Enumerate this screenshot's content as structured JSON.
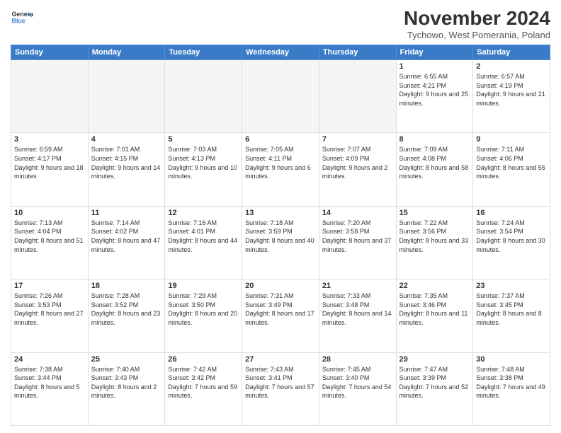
{
  "header": {
    "logo_line1": "General",
    "logo_line2": "Blue",
    "month": "November 2024",
    "location": "Tychowo, West Pomerania, Poland"
  },
  "columns": [
    "Sunday",
    "Monday",
    "Tuesday",
    "Wednesday",
    "Thursday",
    "Friday",
    "Saturday"
  ],
  "weeks": [
    [
      {
        "day": "",
        "info": ""
      },
      {
        "day": "",
        "info": ""
      },
      {
        "day": "",
        "info": ""
      },
      {
        "day": "",
        "info": ""
      },
      {
        "day": "",
        "info": ""
      },
      {
        "day": "1",
        "info": "Sunrise: 6:55 AM\nSunset: 4:21 PM\nDaylight: 9 hours\nand 25 minutes."
      },
      {
        "day": "2",
        "info": "Sunrise: 6:57 AM\nSunset: 4:19 PM\nDaylight: 9 hours\nand 21 minutes."
      }
    ],
    [
      {
        "day": "3",
        "info": "Sunrise: 6:59 AM\nSunset: 4:17 PM\nDaylight: 9 hours\nand 18 minutes."
      },
      {
        "day": "4",
        "info": "Sunrise: 7:01 AM\nSunset: 4:15 PM\nDaylight: 9 hours\nand 14 minutes."
      },
      {
        "day": "5",
        "info": "Sunrise: 7:03 AM\nSunset: 4:13 PM\nDaylight: 9 hours\nand 10 minutes."
      },
      {
        "day": "6",
        "info": "Sunrise: 7:05 AM\nSunset: 4:11 PM\nDaylight: 9 hours\nand 6 minutes."
      },
      {
        "day": "7",
        "info": "Sunrise: 7:07 AM\nSunset: 4:09 PM\nDaylight: 9 hours\nand 2 minutes."
      },
      {
        "day": "8",
        "info": "Sunrise: 7:09 AM\nSunset: 4:08 PM\nDaylight: 8 hours\nand 58 minutes."
      },
      {
        "day": "9",
        "info": "Sunrise: 7:11 AM\nSunset: 4:06 PM\nDaylight: 8 hours\nand 55 minutes."
      }
    ],
    [
      {
        "day": "10",
        "info": "Sunrise: 7:13 AM\nSunset: 4:04 PM\nDaylight: 8 hours\nand 51 minutes."
      },
      {
        "day": "11",
        "info": "Sunrise: 7:14 AM\nSunset: 4:02 PM\nDaylight: 8 hours\nand 47 minutes."
      },
      {
        "day": "12",
        "info": "Sunrise: 7:16 AM\nSunset: 4:01 PM\nDaylight: 8 hours\nand 44 minutes."
      },
      {
        "day": "13",
        "info": "Sunrise: 7:18 AM\nSunset: 3:59 PM\nDaylight: 8 hours\nand 40 minutes."
      },
      {
        "day": "14",
        "info": "Sunrise: 7:20 AM\nSunset: 3:58 PM\nDaylight: 8 hours\nand 37 minutes."
      },
      {
        "day": "15",
        "info": "Sunrise: 7:22 AM\nSunset: 3:56 PM\nDaylight: 8 hours\nand 33 minutes."
      },
      {
        "day": "16",
        "info": "Sunrise: 7:24 AM\nSunset: 3:54 PM\nDaylight: 8 hours\nand 30 minutes."
      }
    ],
    [
      {
        "day": "17",
        "info": "Sunrise: 7:26 AM\nSunset: 3:53 PM\nDaylight: 8 hours\nand 27 minutes."
      },
      {
        "day": "18",
        "info": "Sunrise: 7:28 AM\nSunset: 3:52 PM\nDaylight: 8 hours\nand 23 minutes."
      },
      {
        "day": "19",
        "info": "Sunrise: 7:29 AM\nSunset: 3:50 PM\nDaylight: 8 hours\nand 20 minutes."
      },
      {
        "day": "20",
        "info": "Sunrise: 7:31 AM\nSunset: 3:49 PM\nDaylight: 8 hours\nand 17 minutes."
      },
      {
        "day": "21",
        "info": "Sunrise: 7:33 AM\nSunset: 3:48 PM\nDaylight: 8 hours\nand 14 minutes."
      },
      {
        "day": "22",
        "info": "Sunrise: 7:35 AM\nSunset: 3:46 PM\nDaylight: 8 hours\nand 11 minutes."
      },
      {
        "day": "23",
        "info": "Sunrise: 7:37 AM\nSunset: 3:45 PM\nDaylight: 8 hours\nand 8 minutes."
      }
    ],
    [
      {
        "day": "24",
        "info": "Sunrise: 7:38 AM\nSunset: 3:44 PM\nDaylight: 8 hours\nand 5 minutes."
      },
      {
        "day": "25",
        "info": "Sunrise: 7:40 AM\nSunset: 3:43 PM\nDaylight: 8 hours\nand 2 minutes."
      },
      {
        "day": "26",
        "info": "Sunrise: 7:42 AM\nSunset: 3:42 PM\nDaylight: 7 hours\nand 59 minutes."
      },
      {
        "day": "27",
        "info": "Sunrise: 7:43 AM\nSunset: 3:41 PM\nDaylight: 7 hours\nand 57 minutes."
      },
      {
        "day": "28",
        "info": "Sunrise: 7:45 AM\nSunset: 3:40 PM\nDaylight: 7 hours\nand 54 minutes."
      },
      {
        "day": "29",
        "info": "Sunrise: 7:47 AM\nSunset: 3:39 PM\nDaylight: 7 hours\nand 52 minutes."
      },
      {
        "day": "30",
        "info": "Sunrise: 7:48 AM\nSunset: 3:38 PM\nDaylight: 7 hours\nand 49 minutes."
      }
    ]
  ]
}
